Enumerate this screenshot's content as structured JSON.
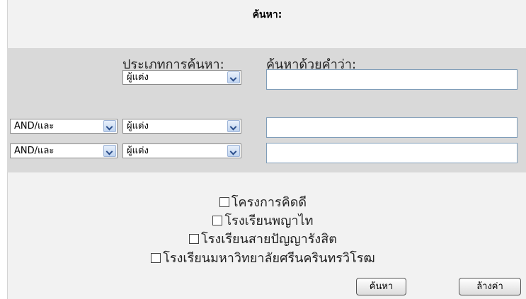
{
  "form": {
    "title": "ค้นหา:",
    "search_type_label": "ประเภทการค้นหา:",
    "search_words_label": "ค้นหาด้วยคำว่า:"
  },
  "rows": [
    {
      "operator": "",
      "field": "ผู้แต่ง",
      "query": ""
    },
    {
      "operator": "AND/และ",
      "field": "ผู้แต่ง",
      "query": ""
    },
    {
      "operator": "AND/และ",
      "field": "ผู้แต่ง",
      "query": ""
    }
  ],
  "collections": [
    {
      "label": "โครงการคิดดี",
      "checked": false
    },
    {
      "label": "โรงเรียนพญาไท",
      "checked": false
    },
    {
      "label": "โรงเรียนสายปัญญารังสิต",
      "checked": false
    },
    {
      "label": "โรงเรียนมหาวิทยาลัยศรีนครินทรวิโรฒ",
      "checked": false
    }
  ],
  "buttons": {
    "search": "ค้นหา",
    "clear": "ล้างค่า"
  }
}
